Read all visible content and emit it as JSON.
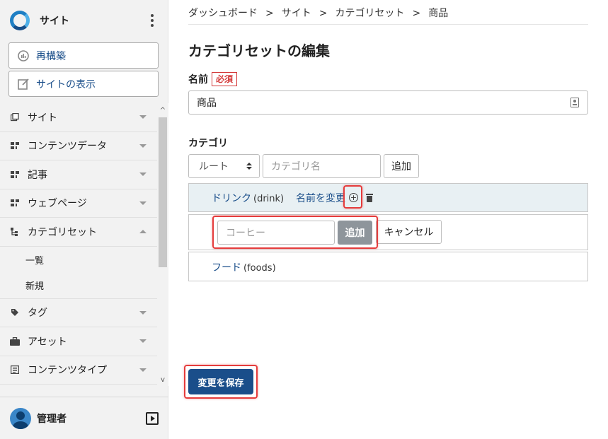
{
  "sidebar": {
    "site_name": "サイト",
    "buttons": {
      "rebuild": "再構築",
      "view_site": "サイトの表示"
    },
    "nav": [
      {
        "label": "サイト",
        "icon": "site-icon"
      },
      {
        "label": "コンテンツデータ",
        "icon": "content-data-icon"
      },
      {
        "label": "記事",
        "icon": "entry-icon"
      },
      {
        "label": "ウェブページ",
        "icon": "webpage-icon"
      },
      {
        "label": "カテゴリセット",
        "icon": "category-set-icon",
        "expanded": true
      },
      {
        "label": "タグ",
        "icon": "tag-icon"
      },
      {
        "label": "アセット",
        "icon": "asset-icon"
      },
      {
        "label": "コンテンツタイプ",
        "icon": "content-type-icon"
      }
    ],
    "subnav": [
      "一覧",
      "新規"
    ],
    "user": {
      "name": "管理者"
    }
  },
  "breadcrumb": [
    "ダッシュボード",
    "サイト",
    "カテゴリセット",
    "商品"
  ],
  "breadcrumb_separator": ">",
  "page_title": "カテゴリセットの編集",
  "name_field": {
    "label": "名前",
    "required_badge": "必須",
    "value": "商品"
  },
  "category": {
    "label": "カテゴリ",
    "select_value": "ルート",
    "name_placeholder": "カテゴリ名",
    "add_button": "追加",
    "tree": [
      {
        "name": "ドリンク",
        "slug": "(drink)",
        "rename": "名前を変更"
      },
      {
        "name": "フード",
        "slug": "(foods)"
      }
    ],
    "inline_add": {
      "placeholder": "コーヒー",
      "add_button": "追加",
      "cancel_button": "キャンセル"
    }
  },
  "save_button": "変更を保存",
  "colors": {
    "accent": "#1a4e8a",
    "highlight": "#e53c3c",
    "required": "#d43a3a",
    "active_row": "#e8f0f3",
    "sidebar_bg": "#f2f2f2"
  }
}
